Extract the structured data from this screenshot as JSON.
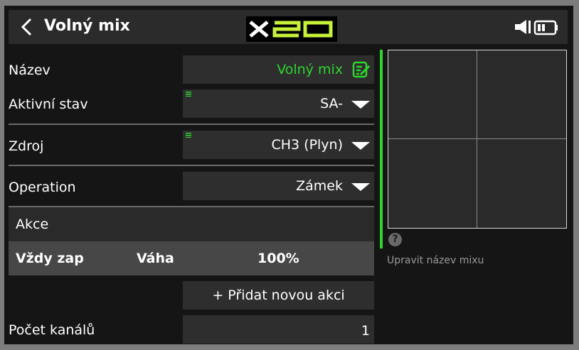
{
  "header": {
    "title": "Volný mix",
    "logo_text": "X20",
    "colors": {
      "logo_accent": "#c7f23a"
    }
  },
  "form": {
    "name": {
      "label": "Název",
      "value": "Volný mix",
      "value_color": "#2ed52e"
    },
    "active_state": {
      "label": "Aktivní stav",
      "value": "SA-"
    },
    "source": {
      "label": "Zdroj",
      "value": "CH3 (Plyn)"
    },
    "operation": {
      "label": "Operation",
      "value": "Zámek"
    }
  },
  "actions": {
    "header": "Akce",
    "row": {
      "condition": "Vždy zap",
      "weight_label": "Váha",
      "weight_value": "100%"
    },
    "add_button": "+ Přidat novou akci"
  },
  "channels": {
    "label": "Počet kanálů",
    "value": "1"
  },
  "help": {
    "icon_text": "?",
    "text": "Upravit název mixu"
  },
  "icons": [
    "back-icon",
    "speaker-icon",
    "battery-icon",
    "edit-icon",
    "dropdown-arrow-icon",
    "help-icon"
  ]
}
